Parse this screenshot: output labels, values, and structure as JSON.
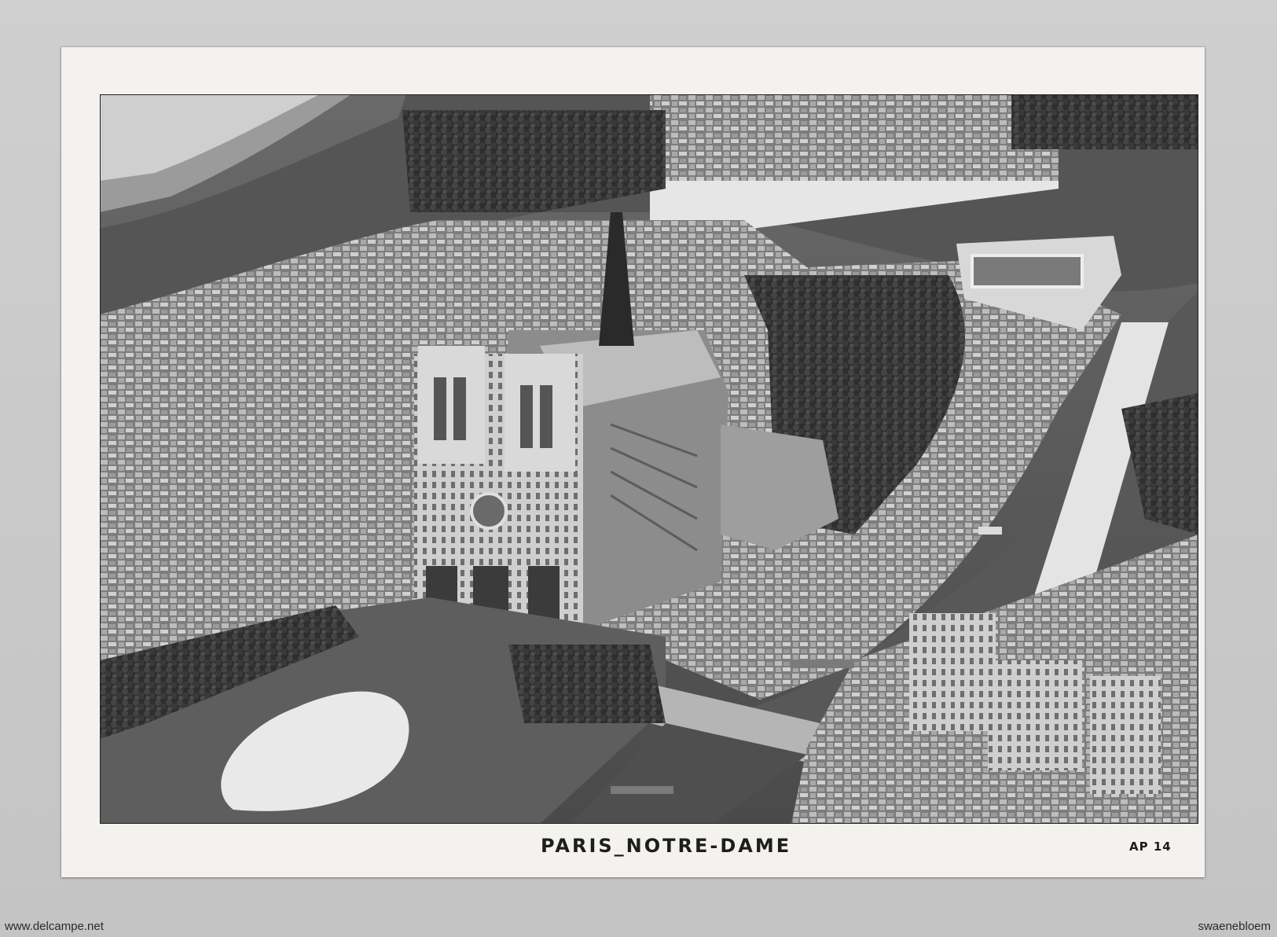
{
  "postcard": {
    "title": "PARIS_NOTRE-DAME",
    "code": "AP 14"
  },
  "photo": {
    "subject": "aerial-photograph"
  },
  "watermarks": {
    "left": "www.delcampe.net",
    "right": "swaenebloem"
  },
  "colors": {
    "card": "#f3f2ee",
    "ink": "#1d1d1d",
    "scan_background": "#c9c9c9"
  }
}
